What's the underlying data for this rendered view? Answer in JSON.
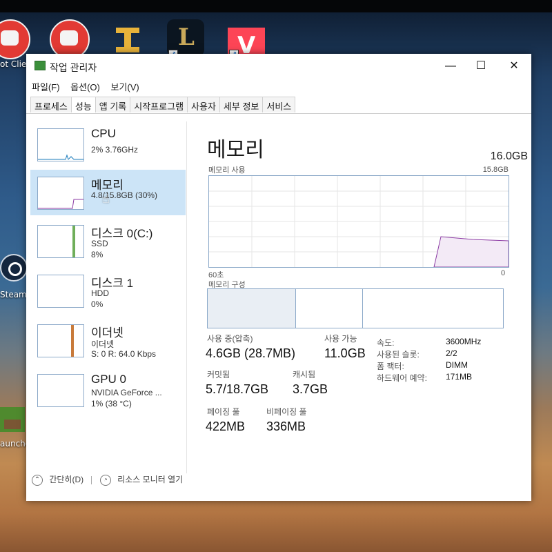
{
  "desktop": {
    "icons": [
      {
        "label": "ot Clier"
      },
      {
        "label": ""
      },
      {
        "label": ""
      },
      {
        "label": ""
      },
      {
        "label": ""
      },
      {
        "label": "Steam"
      },
      {
        "label": "auncher"
      }
    ]
  },
  "window": {
    "title": "작업 관리자",
    "controls": {
      "minimize": "—",
      "maximize": "☐",
      "close": "✕"
    },
    "menu": [
      "파일(F)",
      "옵션(O)",
      "보기(V)"
    ],
    "tabs": [
      "프로세스",
      "성능",
      "앱 기록",
      "시작프로그램",
      "사용자",
      "세부 정보",
      "서비스"
    ],
    "active_tab": "성능"
  },
  "sidebar": {
    "items": [
      {
        "name": "CPU",
        "line1": "2% 3.76GHz",
        "line2": ""
      },
      {
        "name": "메모리",
        "line1": "4.8/15.8GB (30%)",
        "line2": ""
      },
      {
        "name": "디스크 0(C:)",
        "line1": "SSD",
        "line2": "8%"
      },
      {
        "name": "디스크 1",
        "line1": "HDD",
        "line2": "0%"
      },
      {
        "name": "이더넷",
        "line1": "이더넷",
        "line2": "S: 0 R: 64.0 Kbps"
      },
      {
        "name": "GPU 0",
        "line1": "NVIDIA GeForce ...",
        "line2": "1% (38 °C)"
      }
    ],
    "selected_index": 1
  },
  "memory": {
    "title": "메모리",
    "capacity": "16.0GB",
    "usage_label": "메모리 사용",
    "usage_max": "15.8GB",
    "time_start": "60초",
    "time_end": "0",
    "composition_label": "메모리 구성",
    "usage_fraction": 0.3,
    "stats": {
      "in_use_label": "사용 중(압축)",
      "in_use_value": "4.6GB (28.7MB)",
      "available_label": "사용 가능",
      "available_value": "11.0GB",
      "committed_label": "커밋됨",
      "committed_value": "5.7/18.7GB",
      "cached_label": "캐시됨",
      "cached_value": "3.7GB",
      "paged_label": "페이징 풀",
      "paged_value": "422MB",
      "nonpaged_label": "비페이징 풀",
      "nonpaged_value": "336MB"
    },
    "details": [
      {
        "label": "속도:",
        "value": "3600MHz"
      },
      {
        "label": "사용된 슬롯:",
        "value": "2/2"
      },
      {
        "label": "폼 팩터:",
        "value": "DIMM"
      },
      {
        "label": "하드웨어 예약:",
        "value": "171MB"
      }
    ]
  },
  "footer": {
    "fewer_details": "간단히(D)",
    "resource_monitor": "리소스 모니터 열기"
  }
}
